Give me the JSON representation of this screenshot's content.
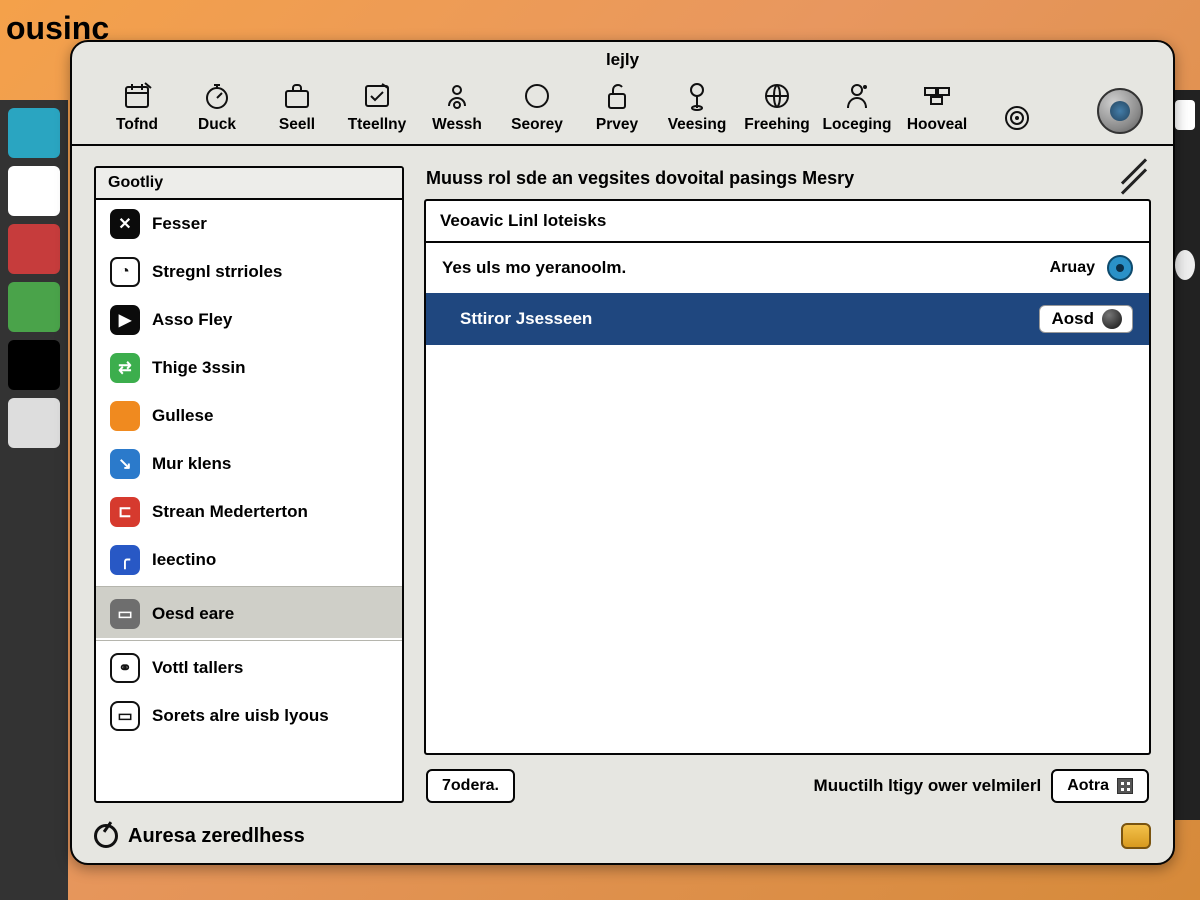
{
  "background": {
    "corner_word": "ousinc"
  },
  "window": {
    "title": "lejly",
    "toolbar": [
      {
        "label": "Tofnd",
        "icon": "calendar"
      },
      {
        "label": "Duck",
        "icon": "stopwatch"
      },
      {
        "label": "Seell",
        "icon": "briefcase"
      },
      {
        "label": "Tteellny",
        "icon": "note-check"
      },
      {
        "label": "Wessh",
        "icon": "person-ring"
      },
      {
        "label": "Seorey",
        "icon": "circle"
      },
      {
        "label": "Prvey",
        "icon": "lock-open"
      },
      {
        "label": "Veesing",
        "icon": "pin"
      },
      {
        "label": "Freehing",
        "icon": "globe"
      },
      {
        "label": "Loceging",
        "icon": "person-dot"
      },
      {
        "label": "Hooveal",
        "icon": "bricks"
      },
      {
        "label": "",
        "icon": "target"
      }
    ],
    "big_button_icon": "sphere"
  },
  "sidebar": {
    "header": "Gootliy",
    "items": [
      {
        "label": "Fesser",
        "icon_style": "ic-black",
        "glyph": "✕"
      },
      {
        "label": "Stregnl strrioles",
        "icon_style": "ic-white",
        "glyph": "◔"
      },
      {
        "label": "Asso Fley",
        "icon_style": "ic-black",
        "glyph": "▶"
      },
      {
        "label": "Thige 3ssin",
        "icon_style": "ic-green",
        "glyph": "⇄"
      },
      {
        "label": "Gullese",
        "icon_style": "ic-orange",
        "glyph": " "
      },
      {
        "label": "Mur klens",
        "icon_style": "ic-blue",
        "glyph": "↘"
      },
      {
        "label": "Strean Mederterton",
        "icon_style": "ic-red",
        "glyph": "⊏"
      },
      {
        "label": "Ieectino",
        "icon_style": "ic-blue2",
        "glyph": "╭"
      },
      {
        "label": "Oesd eare",
        "icon_style": "ic-gray",
        "glyph": "▭",
        "selected": true,
        "sep": true
      },
      {
        "label": "Vottl tallers",
        "icon_style": "ic-outline",
        "glyph": "⚭",
        "sep": true
      },
      {
        "label": "Sorets alre uisb lyous",
        "icon_style": "ic-outline",
        "glyph": "▭"
      }
    ]
  },
  "main": {
    "heading": "Muuss rol sde an vegsites dovoital pasings Mesry",
    "panel_header": "Veoavic Linl loteisks",
    "rows": [
      {
        "label": "Yes uls mo yeranoolm.",
        "trailing": "Aruay",
        "dot": true
      },
      {
        "label": "Sttiror Jsesseen",
        "selected": true,
        "pill": "Aosd"
      }
    ],
    "footer": {
      "left_button": "7odera.",
      "right_text": "Muuctilh ltigy ower velmilerl",
      "right_button": "Aotra"
    }
  },
  "status": {
    "text": "Auresa zeredlhess"
  }
}
